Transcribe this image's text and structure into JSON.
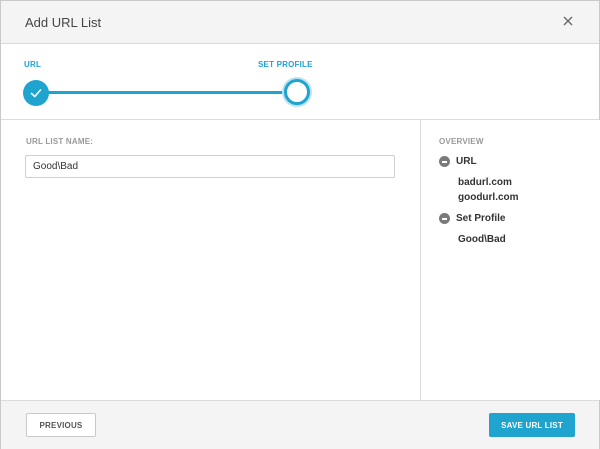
{
  "modal": {
    "title": "Add URL List",
    "close_icon": "close-icon"
  },
  "stepper": {
    "steps": [
      {
        "label": "URL",
        "state": "complete"
      },
      {
        "label": "SET PROFILE",
        "state": "current"
      }
    ],
    "accent_color": "#1fa3cf"
  },
  "form": {
    "name_label": "URL LIST NAME:",
    "name_value": "Good\\Bad"
  },
  "overview": {
    "title": "OVERVIEW",
    "sections": [
      {
        "heading": "URL",
        "values": [
          "badurl.com",
          "goodurl.com"
        ]
      },
      {
        "heading": "Set Profile",
        "values": [
          "Good\\Bad"
        ]
      }
    ]
  },
  "footer": {
    "previous_label": "PREVIOUS",
    "save_label": "SAVE URL LIST"
  }
}
